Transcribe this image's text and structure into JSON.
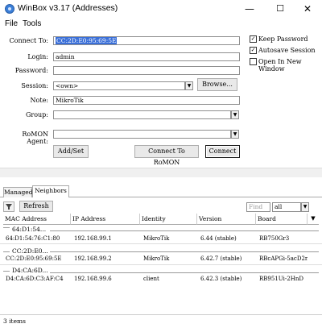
{
  "window": {
    "title": "WinBox v3.17 (Addresses)",
    "minimize": "—",
    "maximize": "☐",
    "close": "✕"
  },
  "menu": {
    "file": "File",
    "tools": "Tools"
  },
  "form": {
    "connect_to_label": "Connect To:",
    "connect_to_value": "CC:2D:E0:95:69:5E",
    "login_label": "Login:",
    "login_value": "admin",
    "password_label": "Password:",
    "password_value": "",
    "session_label": "Session:",
    "session_value": "<own>",
    "browse_label": "Browse...",
    "note_label": "Note:",
    "note_value": "MikroTik",
    "group_label": "Group:",
    "group_value": "",
    "romon_label": "RoMON Agent:",
    "romon_value": ""
  },
  "options": {
    "keep_password": {
      "label": "Keep Password",
      "checked": true
    },
    "autosave_session": {
      "label": "Autosave Session",
      "checked": true
    },
    "open_new_window": {
      "label": "Open In New Window",
      "checked": false
    }
  },
  "buttons": {
    "add_set": "Add/Set",
    "connect_romon": "Connect To RoMON",
    "connect": "Connect"
  },
  "tabs": [
    "Managed",
    "Neighbors"
  ],
  "toolbar": {
    "refresh": "Refresh",
    "find_placeholder": "Find",
    "filter_value": "all"
  },
  "table": {
    "columns": [
      "MAC Address",
      "IP Address",
      "Identity",
      "Version",
      "Board"
    ],
    "groups": [
      {
        "header": "64:D1:54...",
        "row": [
          "64:D1:54:76:C1:80",
          "192.168.99.1",
          "MikroTik",
          "6.44 (stable)",
          "RB750Gr3"
        ]
      },
      {
        "header": "CC:2D:E0...",
        "row": [
          "CC:2D:E0:95:69:5E",
          "192.168.99.2",
          "MikroTik",
          "6.42.7 (stable)",
          "RBcAPGi-5acD2nD"
        ]
      },
      {
        "header": "D4:CA:6D...",
        "row": [
          "D4:CA:6D:C3:AF:C4",
          "192.168.99.6",
          "client",
          "6.42.3 (stable)",
          "RB951Ui-2HnD"
        ]
      }
    ]
  },
  "status": {
    "count": "3 items"
  },
  "colors": {
    "selection": "#3a6fd8",
    "icon": "#3b7fd8"
  }
}
